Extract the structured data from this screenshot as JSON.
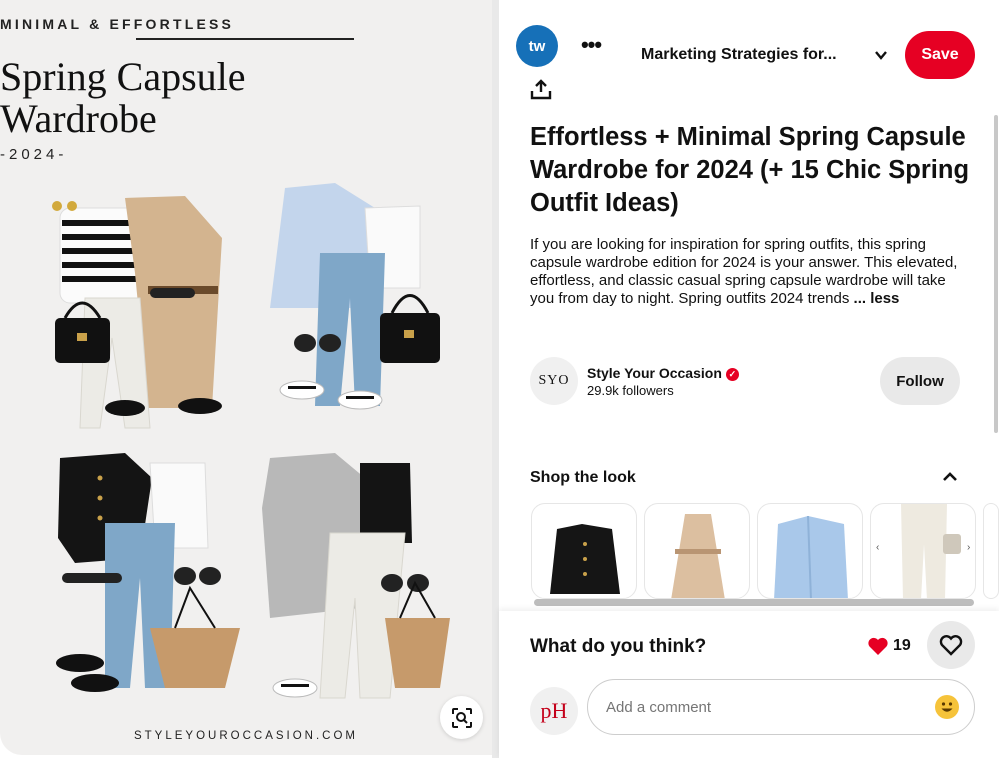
{
  "pin": {
    "kicker": "MINIMAL & EFFORTLESS",
    "title_line1": "Spring Capsule",
    "title_line2": "Wardrobe",
    "year": "-2024-",
    "site": "STYLEYOUROCCASION.COM"
  },
  "header": {
    "board_avatar_text": "tw",
    "board_name": "Marketing Strategies for...",
    "save_label": "Save"
  },
  "article": {
    "title": "Effortless + Minimal Spring Capsule Wardrobe for 2024 (+ 15 Chic Spring Outfit Ideas)",
    "description": "If you are looking for inspiration for spring outfits, this spring capsule wardrobe edition for 2024 is your answer. This elevated, effortless, and classic casual spring capsule wardrobe will take you from day to night. Spring outfits 2024 trends",
    "less_label": "... less"
  },
  "creator": {
    "avatar_text": "SYO",
    "name": "Style Your Occasion",
    "followers": "29.9k followers",
    "follow_label": "Follow"
  },
  "shop": {
    "heading": "Shop the look",
    "items": [
      "black tweed jacket",
      "beige trench coat",
      "light blue shirt",
      "cream trousers"
    ]
  },
  "comments": {
    "heading": "What do you think?",
    "reaction_count": "19",
    "placeholder": "Add a comment",
    "user_avatar_text": "pH"
  },
  "colors": {
    "accent": "#e60023",
    "board_avatar": "#1670b8"
  }
}
